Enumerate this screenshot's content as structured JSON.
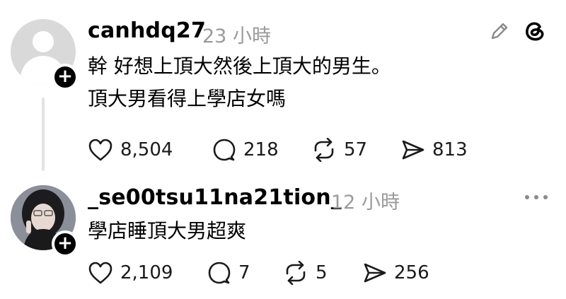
{
  "post": {
    "username": "canhdq27",
    "time": "23 小時",
    "lines": [
      "幹 好想上頂大然後上頂大的男生。",
      "頂大男看得上學店女嗎"
    ],
    "likes": "8,504",
    "replies": "218",
    "reposts": "57",
    "shares": "813"
  },
  "reply": {
    "username": "_se00tsu11na21tion_",
    "time": "12 小時",
    "text": "學店睡頂大男超爽",
    "likes": "2,109",
    "replies": "7",
    "reposts": "5",
    "shares": "256"
  },
  "icons": {
    "follow": "+",
    "edit": "pencil-icon",
    "brand": "threads-logo",
    "more": "more-dots-icon"
  }
}
